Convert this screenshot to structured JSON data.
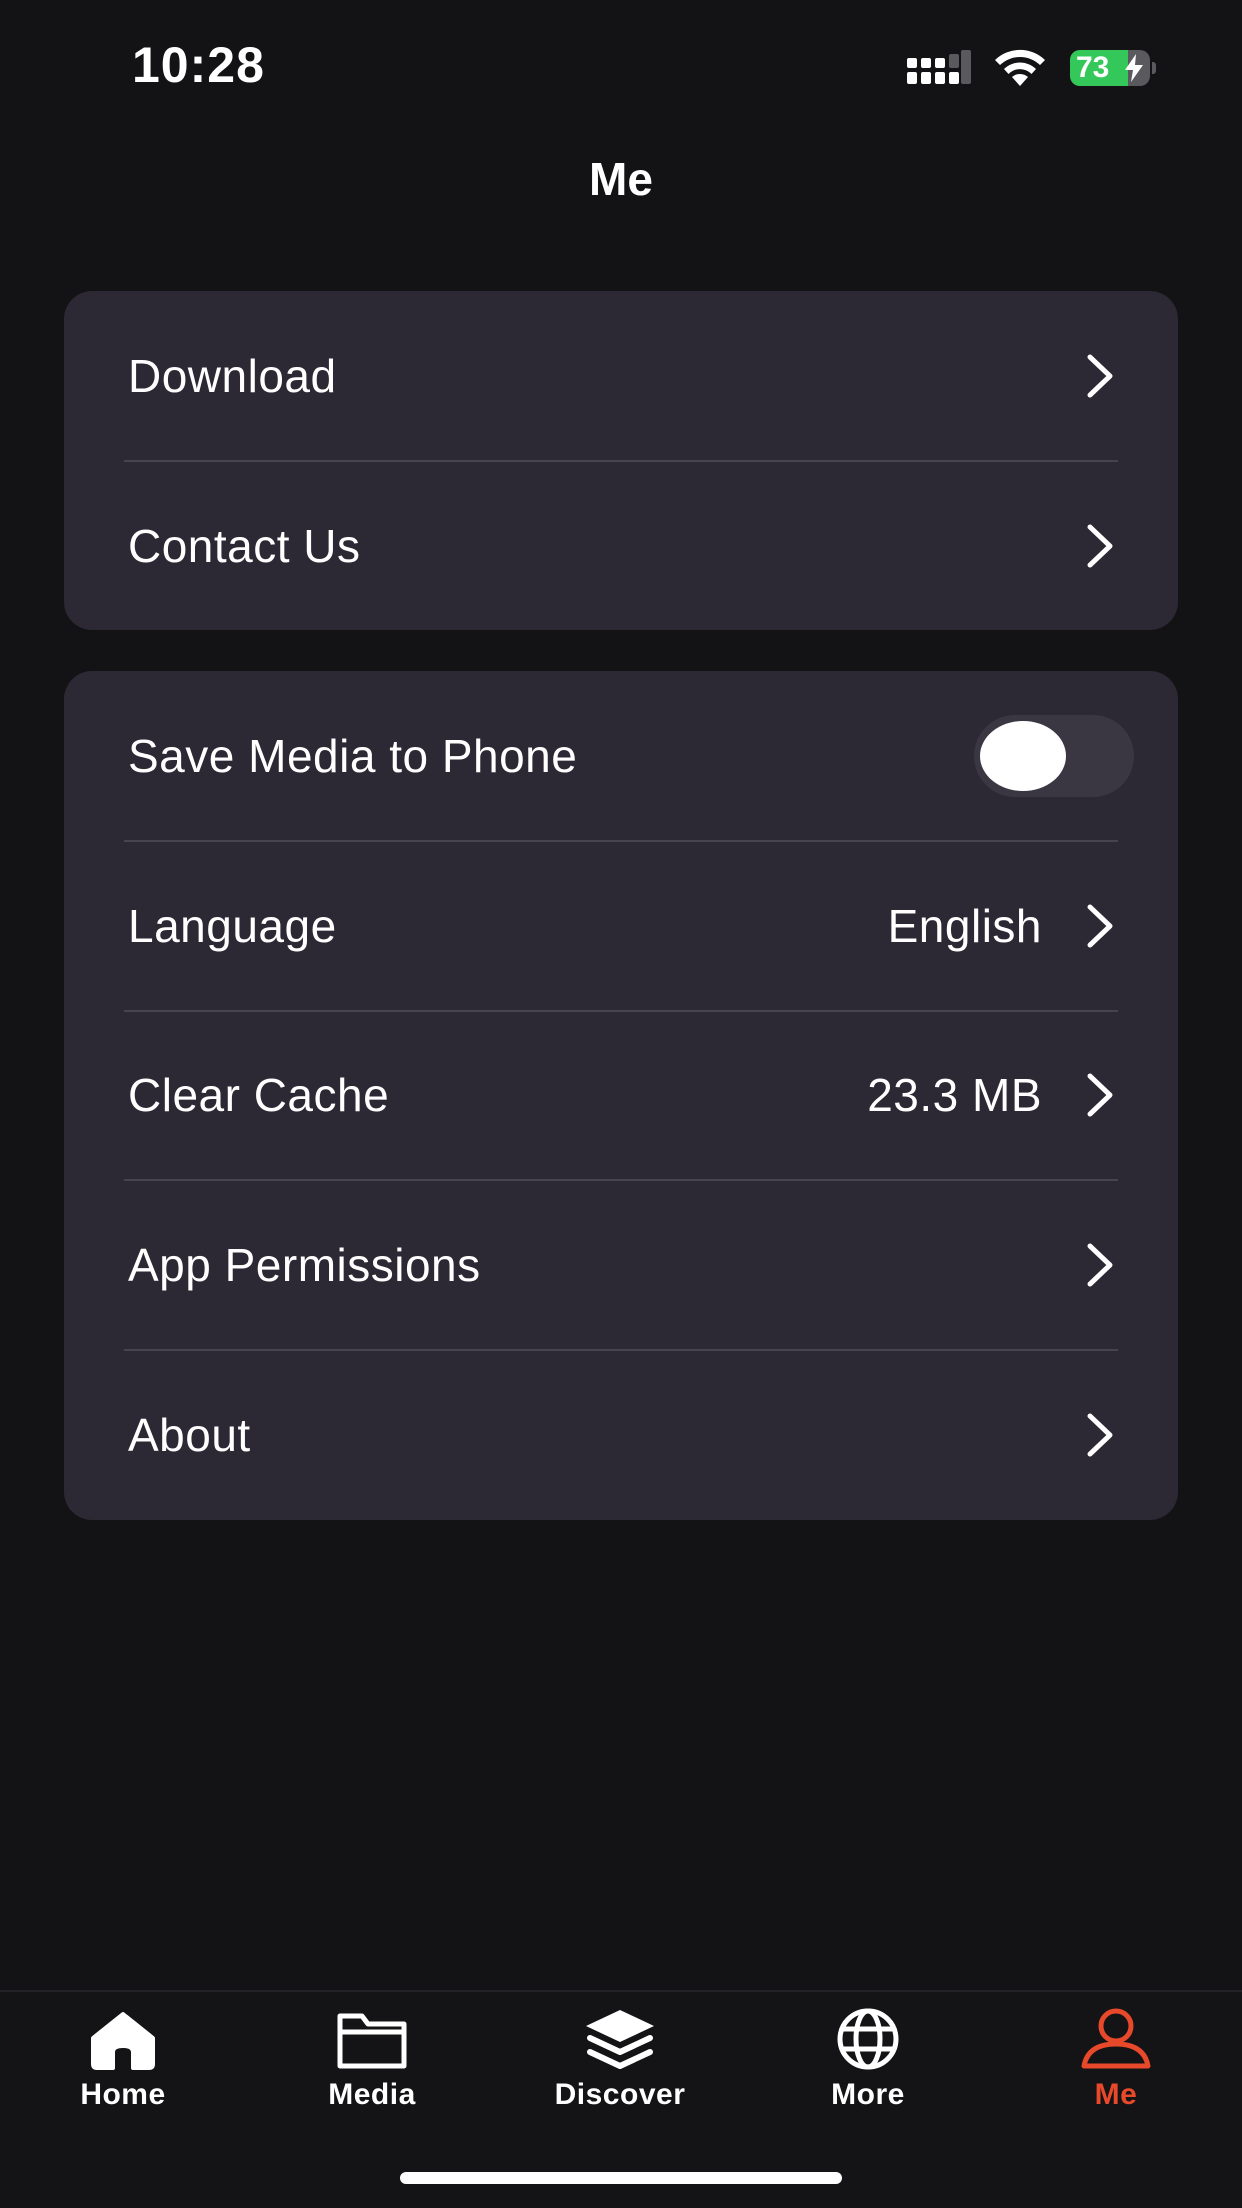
{
  "status_bar": {
    "time": "10:28",
    "battery_level": "73",
    "battery_fraction": 0.73,
    "battery_color": "#34c759"
  },
  "header": {
    "title": "Me"
  },
  "card_primary": {
    "items": [
      {
        "label": "Download",
        "icon": "chevron-right-icon"
      },
      {
        "label": "Contact Us",
        "icon": "chevron-right-icon"
      }
    ]
  },
  "card_settings": {
    "save_media": {
      "label": "Save Media to Phone",
      "enabled": false
    },
    "language": {
      "label": "Language",
      "value": "English",
      "icon": "chevron-right-icon"
    },
    "clear_cache": {
      "label": "Clear Cache",
      "value": "23.3 MB",
      "icon": "chevron-right-icon"
    },
    "app_permissions": {
      "label": "App Permissions",
      "icon": "chevron-right-icon"
    },
    "about": {
      "label": "About",
      "icon": "chevron-right-icon"
    }
  },
  "tab_bar": {
    "active_color": "#e8492a",
    "tabs": [
      {
        "label": "Home",
        "icon": "home-icon"
      },
      {
        "label": "Media",
        "icon": "folder-icon"
      },
      {
        "label": "Discover",
        "icon": "layers-icon"
      },
      {
        "label": "More",
        "icon": "globe-icon"
      },
      {
        "label": "Me",
        "icon": "person-icon",
        "active": true
      }
    ]
  }
}
